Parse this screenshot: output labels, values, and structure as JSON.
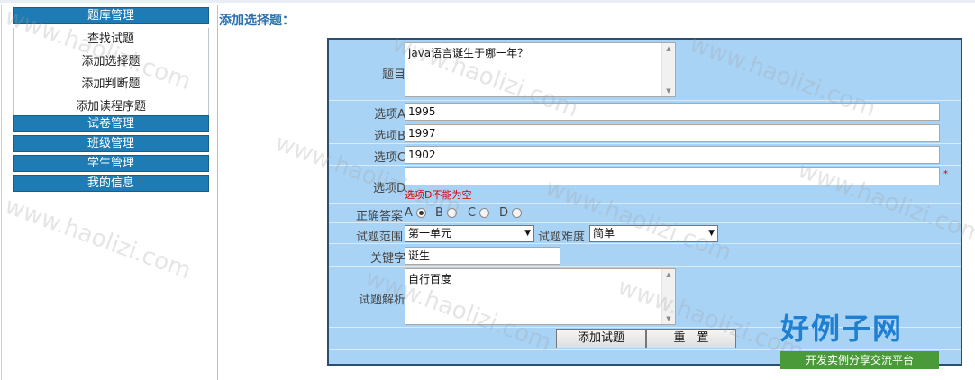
{
  "sidebar": {
    "question_bank": "题库管理",
    "sub_items": [
      "查找试题",
      "添加选择题",
      "添加判断题",
      "添加读程序题"
    ],
    "exam_paper": "试卷管理",
    "class_mgmt": "班级管理",
    "student_mgmt": "学生管理",
    "my_info": "我的信息"
  },
  "page_title": "添加选择题：",
  "form": {
    "question_label": "题目",
    "question_value": "java语言诞生于哪一年？",
    "option_a_label": "选项A",
    "option_a_value": "1995",
    "option_b_label": "选项B",
    "option_b_value": "1997",
    "option_c_label": "选项C",
    "option_c_value": "1902",
    "option_d_label": "选项D",
    "option_d_value": "",
    "option_d_error": "选项D不能为空",
    "required_mark": "*",
    "answer_label": "正确答案",
    "answer_options": [
      "A",
      "B",
      "C",
      "D"
    ],
    "answer_selected": "A",
    "scope_label": "试题范围",
    "scope_value": "第一单元",
    "difficulty_label": "试题难度",
    "difficulty_value": "简单",
    "keyword_label": "关键字",
    "keyword_value": "诞生",
    "analysis_label": "试题解析",
    "analysis_value": "自行百度",
    "add_button": "添加试题",
    "reset_button": "重　置"
  },
  "watermark": "www.haolizi.com",
  "logo": {
    "title": "好例子网",
    "subtitle": "开发实例分享交流平台"
  }
}
